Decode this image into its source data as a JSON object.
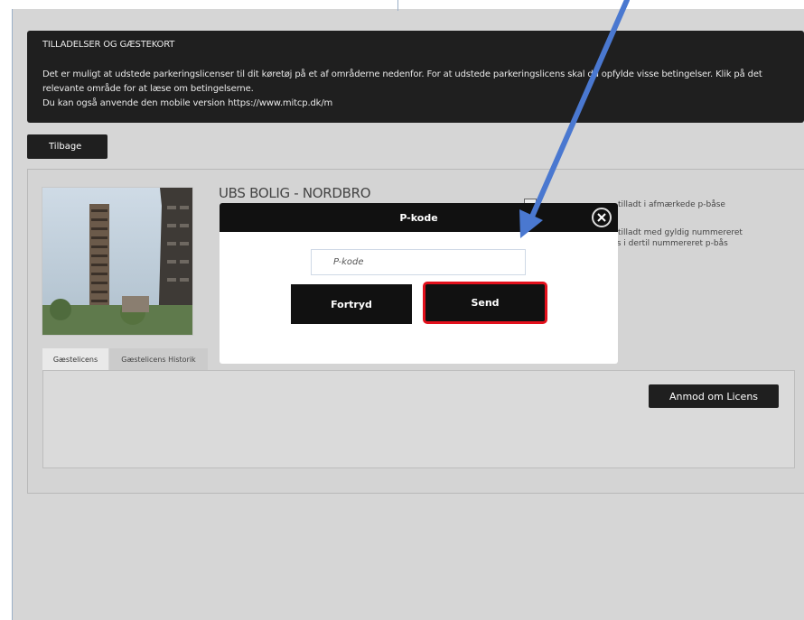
{
  "info": {
    "title": "TILLADELSER OG GÆSTEKORT",
    "line1": "Det er muligt at udstede parkeringslicenser til dit køretøj på et af områderne nedenfor. For at udstede parkeringslicens skal du opfylde visse betingelser. Klik på det",
    "line2": "relevante område for at læse om betingelserne.",
    "line3": "Du kan også anvende den mobile version https://www.mitcp.dk/m"
  },
  "back_button": "Tilbage",
  "location": {
    "title": "UBS BOLIG - NORDBRO",
    "bg_text_1": "tilladt i afmærkede p-båse",
    "bg_text_2": "tilladt med gyldig nummereret",
    "bg_text_3": "ns i dertil nummereret p-bås"
  },
  "tabs": {
    "license": "Gæstelicens",
    "history": "Gæstelicens Historik"
  },
  "request_button": "Anmod om Licens",
  "modal": {
    "title": "P-kode",
    "input_placeholder": "P-kode",
    "cancel_label": "Fortryd",
    "send_label": "Send"
  },
  "colors": {
    "highlight_border": "#e3101c",
    "arrow": "#4a78d0"
  },
  "icons": {
    "close": "close-icon"
  }
}
